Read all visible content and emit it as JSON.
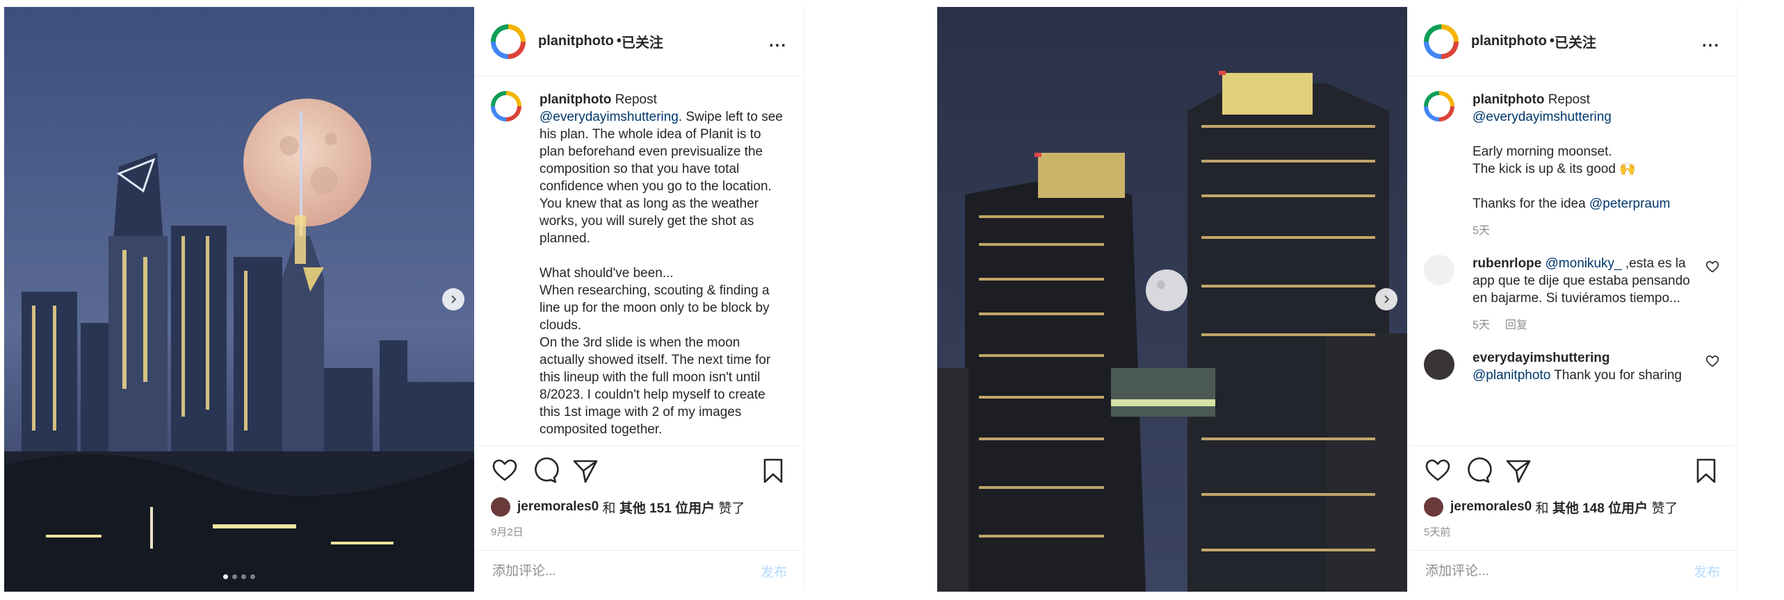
{
  "post1": {
    "username": "planitphoto",
    "follow_sep": "•",
    "follow_status": "已关注",
    "more": "...",
    "caption": {
      "username": "planitphoto",
      "label": "Repost",
      "tag": "@everydayimshuttering",
      "text": ". Swipe left to see his plan. The whole idea of Planit is to plan beforehand even previsualize the composition so that you have total confidence when you go to the location. You knew that as long as the weather works, you will surely get the shot as planned.\n\nWhat should've been...\nWhen researching, scouting & finding a line up for the moon only to be block by clouds.\nOn the 3rd slide is when the moon actually showed itself. The next time for this lineup with the full moon isn't until 8/2023. I couldn't help myself to create this 1st image with 2 of my images composited together."
    },
    "likes": {
      "user": "jeremorales0",
      "and": "和",
      "others": "其他 151 位用户",
      "suffix": "赞了"
    },
    "date": "9月2日",
    "add_comment_placeholder": "添加评论...",
    "post_button": "发布",
    "carousel_dots": 4
  },
  "post2": {
    "username": "planitphoto",
    "follow_sep": "•",
    "follow_status": "已关注",
    "more": "...",
    "caption": {
      "username": "planitphoto",
      "label": "Repost",
      "tag": "@everydayimshuttering",
      "line1": "Early morning moonset.",
      "line2": "The kick is up & its good 🙌",
      "line3": "Thanks for the idea",
      "tag2": "@peterpraum",
      "time": "5天"
    },
    "comments": [
      {
        "username": "rubenrlope",
        "tag": "@monikuky_",
        "text": " ,esta es la app que te dije que estaba pensando en bajarme. Si tuviéramos tiempo...",
        "time": "5天",
        "reply": "回复"
      },
      {
        "username": "everydayimshuttering",
        "tag": "@planitphoto",
        "text": " Thank you for sharing"
      }
    ],
    "likes": {
      "user": "jeremorales0",
      "and": "和",
      "others": "其他 148 位用户",
      "suffix": "赞了"
    },
    "date": "5天前",
    "add_comment_placeholder": "添加评论...",
    "post_button": "发布"
  }
}
